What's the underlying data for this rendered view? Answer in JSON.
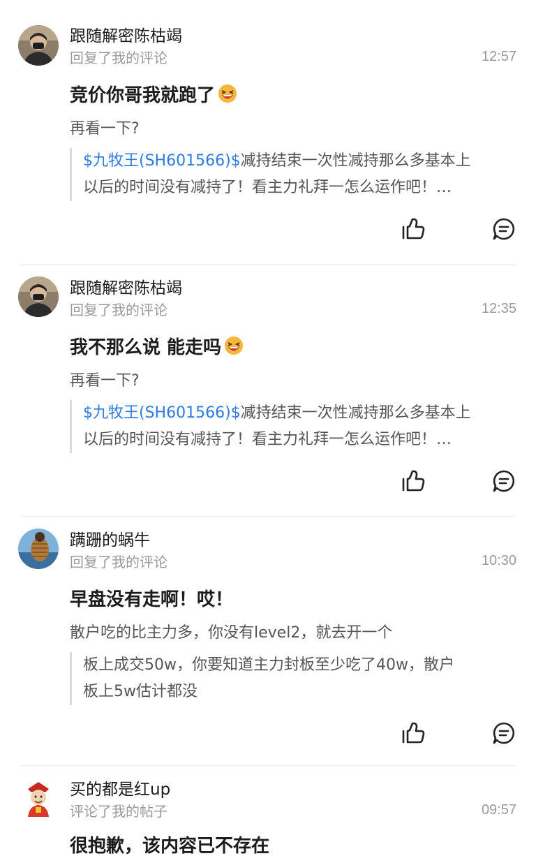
{
  "items": [
    {
      "user": "跟随解密陈枯竭",
      "action": "回复了我的评论",
      "time": "12:57",
      "content": "竞价你哥我就跑了",
      "emoji": "laughing-emoji",
      "secondary": "再看一下?",
      "quote_link": "$九牧王(SH601566)$",
      "quote_line1": "减持结束一次性减持那么多基本上",
      "quote_line2": "以后的时间没有减持了！看主力礼拜一怎么运作吧！…"
    },
    {
      "user": "跟随解密陈枯竭",
      "action": "回复了我的评论",
      "time": "12:35",
      "content": "我不那么说 能走吗",
      "emoji": "laughing-emoji",
      "secondary": "再看一下?",
      "quote_link": "$九牧王(SH601566)$",
      "quote_line1": "减持结束一次性减持那么多基本上",
      "quote_line2": "以后的时间没有减持了！看主力礼拜一怎么运作吧！…"
    },
    {
      "user": "蹒跚的蜗牛",
      "action": "回复了我的评论",
      "time": "10:30",
      "content": "早盘没有走啊！哎！",
      "secondary": "散户吃的比主力多，你没有level2，就去开一个",
      "quote_line1": "板上成交50w，你要知道主力封板至少吃了40w，散户",
      "quote_line2": "板上5w估计都没"
    },
    {
      "user": "买的都是红up",
      "action": "评论了我的帖子",
      "time": "09:57",
      "content": "很抱歉，该内容已不存在"
    }
  ],
  "colors": {
    "link": "#2b7be4",
    "meta": "#9a9a9a",
    "quote_bar": "#dcdcdc"
  },
  "icons": {
    "like": "thumbs-up-icon",
    "comment": "comment-bubble-icon"
  }
}
